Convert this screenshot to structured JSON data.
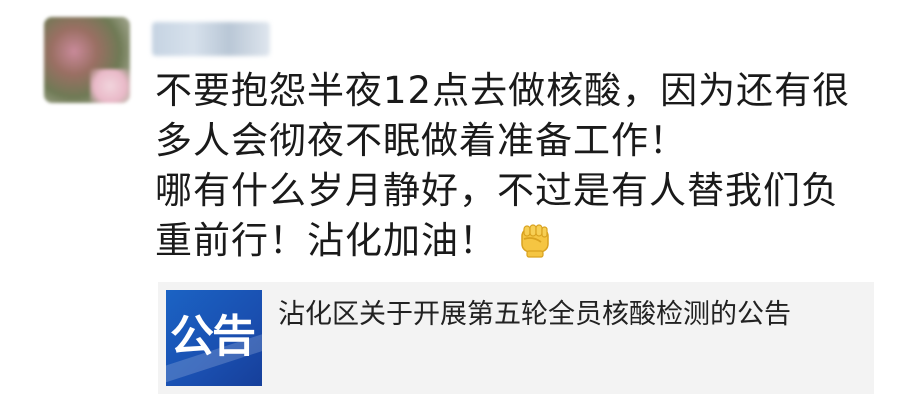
{
  "post": {
    "lines": [
      "不要抱怨半夜12点去做核酸，因为还有很",
      "多人会彻夜不眠做着准备工作！",
      "哪有什么岁月静好，不过是有人替我们负",
      "重前行！沾化加油！"
    ],
    "emoji": "fist-emoji"
  },
  "card": {
    "thumb_text": "公告",
    "title": "沾化区关于开展第五轮全员核酸检测的公告"
  },
  "colors": {
    "text": "#1a1a1a",
    "card_bg": "#f3f3f3",
    "thumb_blue": "#1b63c4",
    "emoji_yellow": "#f5c542"
  }
}
